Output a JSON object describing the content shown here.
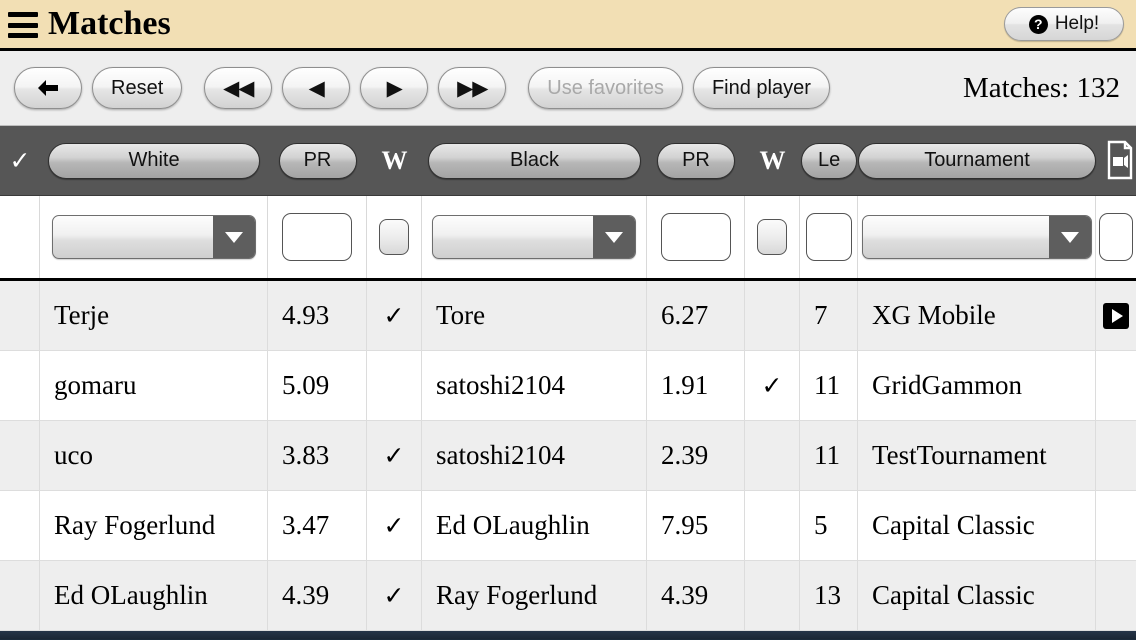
{
  "titlebar": {
    "menu_icon": "hamburger-icon",
    "title": "Matches",
    "help": {
      "label": "Help!",
      "icon": "question-mark-icon"
    }
  },
  "toolbar": {
    "back_label": "←",
    "reset_label": "Reset",
    "first_label": "◀◀",
    "prev_label": "◀",
    "next_label": "▶",
    "last_label": "▶▶",
    "use_favorites_label": "Use favorites",
    "use_favorites_disabled": true,
    "find_player_label": "Find player",
    "matches_count_label": "Matches: 132"
  },
  "column_header": {
    "select_all_check": "✓",
    "white_label": "White",
    "white_pr_label": "PR",
    "white_w_label": "W",
    "black_label": "Black",
    "black_pr_label": "PR",
    "black_w_label": "W",
    "length_label": "Le",
    "tournament_label": "Tournament",
    "video_icon": "video-file-icon"
  },
  "filter_row": {
    "white_select_value": "",
    "white_pr_value": "",
    "white_w_value": "",
    "black_select_value": "",
    "black_pr_value": "",
    "black_w_value": "",
    "length_value": "",
    "tournament_select_value": "",
    "extra_value": ""
  },
  "table": {
    "rows": [
      {
        "check": "",
        "white": "Terje",
        "white_pr": "4.93",
        "white_w": "✓",
        "black": "Tore",
        "black_pr": "6.27",
        "black_w": "",
        "length": "7",
        "tournament": "XG Mobile",
        "play": "play-icon"
      },
      {
        "check": "",
        "white": "gomaru",
        "white_pr": "5.09",
        "white_w": "",
        "black": "satoshi2104",
        "black_pr": "1.91",
        "black_w": "✓",
        "length": "11",
        "tournament": "GridGammon",
        "play": ""
      },
      {
        "check": "",
        "white": "uco",
        "white_pr": "3.83",
        "white_w": "✓",
        "black": "satoshi2104",
        "black_pr": "2.39",
        "black_w": "",
        "length": "11",
        "tournament": "TestTournament",
        "play": ""
      },
      {
        "check": "",
        "white": "Ray Fogerlund",
        "white_pr": "3.47",
        "white_w": "✓",
        "black": "Ed OLaughlin",
        "black_pr": "7.95",
        "black_w": "",
        "length": "5",
        "tournament": "Capital Classic",
        "play": ""
      },
      {
        "check": "",
        "white": "Ed OLaughlin",
        "white_pr": "4.39",
        "white_w": "✓",
        "black": "Ray Fogerlund",
        "black_pr": "4.39",
        "black_w": "",
        "length": "13",
        "tournament": "Capital Classic",
        "play": ""
      }
    ]
  },
  "colors": {
    "titlebar_bg": "#f2dfb4",
    "toolbar_bg": "#eeeeee",
    "header_bg": "#565656",
    "row_alt_bg": "#eeeeee",
    "accent_dark": "#1b2a3a"
  }
}
